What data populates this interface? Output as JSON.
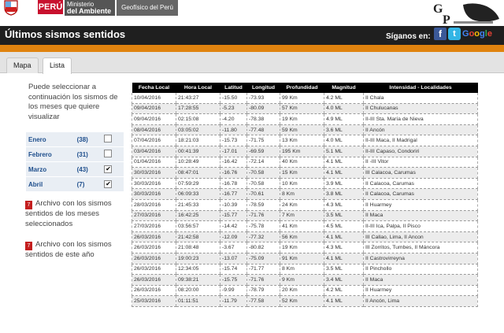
{
  "header": {
    "peru": "PERÚ",
    "ministerio_small": "Ministerio",
    "ministerio": "del Ambiente",
    "igp": "Geofísico del Perú",
    "title": "Últimos sismos sentidos",
    "siganos": "Síganos en:",
    "facebook_icon": "facebook-icon",
    "twitter_icon": "twitter-icon",
    "google_icon": "google-plus-icon"
  },
  "tabs": [
    "Mapa",
    "Lista"
  ],
  "sidebar": {
    "info": "Puede seleccionar a continuación los sismos de los meses que quiere visualizar",
    "months": [
      {
        "name": "Enero",
        "count": "(38)",
        "checked": false
      },
      {
        "name": "Febrero",
        "count": "(31)",
        "checked": false
      },
      {
        "name": "Marzo",
        "count": "(43)",
        "checked": true
      },
      {
        "name": "Abril",
        "count": "(7)",
        "checked": true
      }
    ],
    "file1": "Archivo con los sismos sentidos de los meses seleccionados",
    "file2": "Archivo con los sismos sentidos de este año"
  },
  "table": {
    "headers": [
      "Fecha Local",
      "Hora Local",
      "Latitud",
      "Longitud",
      "Profundidad",
      "Magnitud",
      "Intensidad - Localidades"
    ],
    "rows": [
      [
        "10/04/2016",
        "21:43:27",
        "-15.50",
        "-73.93",
        "99 Km",
        "4.2 ML",
        "II Chala"
      ],
      [
        "09/04/2016",
        "17:28:55",
        "-5.23",
        "-80.09",
        "57 Km",
        "4.0 ML",
        "II Chulucanas"
      ],
      [
        "09/04/2016",
        "02:15:08",
        "-4.20",
        "-78.38",
        "19 Km",
        "4.9 ML",
        "II-III Sta. María de Nieva"
      ],
      [
        "08/04/2016",
        "03:05:02",
        "-11.80",
        "-77.48",
        "59 Km",
        "3.6 ML",
        "II Ancón"
      ],
      [
        "07/04/2016",
        "18:21:03",
        "-15.73",
        "-71.75",
        "13 Km",
        "4.0 ML",
        "II-III Maca, II Madrigal"
      ],
      [
        "03/04/2016",
        "00:41:39",
        "-17.01",
        "-69.59",
        "195 Km",
        "5.1 ML",
        "II-III Capaso, Condoriri"
      ],
      [
        "01/04/2016",
        "10:28:49",
        "-16.42",
        "-72.14",
        "40 Km",
        "4.1 ML",
        "II -III Vitor"
      ],
      [
        "30/03/2016",
        "08:47:01",
        "-16.76",
        "-70.58",
        "15 Km",
        "4.1 ML",
        "III Calacoa, Carumas"
      ],
      [
        "30/03/2016",
        "07:59:29",
        "-16.78",
        "-70.58",
        "10 Km",
        "3.9 ML",
        "II Calacoa, Carumas"
      ],
      [
        "30/03/2016",
        "06:09:33",
        "-16.77",
        "-70.61",
        "8 Km",
        "3.8 ML",
        "II Calacoa, Carumas"
      ],
      [
        "28/03/2016",
        "21:45:33",
        "-10.39",
        "-78.59",
        "24 Km",
        "4.3 ML",
        "II Huarmey"
      ],
      [
        "27/03/2016",
        "16:42:25",
        "-15.77",
        "-71.76",
        "7 Km",
        "3.5 ML",
        "II Maca"
      ],
      [
        "27/03/2016",
        "03:56:57",
        "-14.42",
        "-75.78",
        "41 Km",
        "4.5 ML",
        "II-III Ica, Palpa, II Pisco"
      ],
      [
        "26/03/2016",
        "21:42:58",
        "-12.09",
        "-77.32",
        "56 Km",
        "4.1 ML",
        "III Callao, Lima, II Ancon"
      ],
      [
        "26/03/2016",
        "21:08:48",
        "-3.67",
        "-80.82",
        "19 Km",
        "4.3 ML",
        "III Zorritos, Tumbes, II Máncora"
      ],
      [
        "26/03/2016",
        "19:00:23",
        "-13.07",
        "-75.09",
        "91 Km",
        "4.1 ML",
        "II Castrovirreyna"
      ],
      [
        "26/03/2016",
        "12:34:05",
        "-15.74",
        "-71.77",
        "8 Km",
        "3.5 ML",
        "II Pinchollo"
      ],
      [
        "26/03/2016",
        "09:38:21",
        "-15.75",
        "-71.76",
        "9 Km",
        "3.4 ML",
        "II Maca"
      ],
      [
        "26/03/2016",
        "08:20:00",
        "-9.99",
        "-78.79",
        "20 Km",
        "4.2 ML",
        "II Huarmey"
      ],
      [
        "25/03/2016",
        "01:11:51",
        "-11.79",
        "-77.58",
        "52 Km",
        "4.1 ML",
        "II Ancón, Lima"
      ]
    ]
  }
}
